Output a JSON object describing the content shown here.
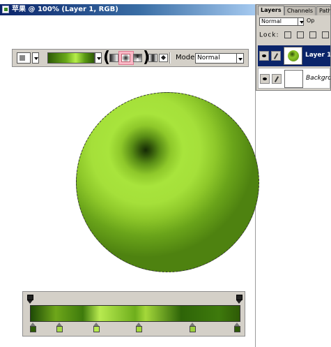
{
  "window": {
    "title": "苹果 @ 100% (Layer 1, RGB)"
  },
  "options_bar": {
    "mode_label": "Mode:",
    "mode_value": "Normal"
  },
  "layers_panel": {
    "tabs": [
      "Layers",
      "Channels",
      "Paths"
    ],
    "blend_mode": "Normal",
    "opacity_label": "Op",
    "lock_label": "Lock:",
    "layers": [
      {
        "name": "Layer 1",
        "selected": true
      },
      {
        "name": "Background",
        "selected": false
      }
    ]
  },
  "gradient_editor": {
    "opacity_stops": [
      0.0,
      1.0
    ],
    "color_stops": [
      {
        "position": 0.0,
        "color": "#2e5a06"
      },
      {
        "position": 0.13,
        "color": "#a6d84a"
      },
      {
        "position": 0.31,
        "color": "#b8ea50"
      },
      {
        "position": 0.52,
        "color": "#a4d83a"
      },
      {
        "position": 0.78,
        "color": "#9cd03e"
      },
      {
        "position": 1.0,
        "color": "#2e5a06"
      }
    ]
  },
  "colors": {
    "titlebar_start": "#0a246a",
    "selection_highlight": "#f9b8c6",
    "apple_green": "#8ec82a",
    "apple_center": "#152a05"
  }
}
